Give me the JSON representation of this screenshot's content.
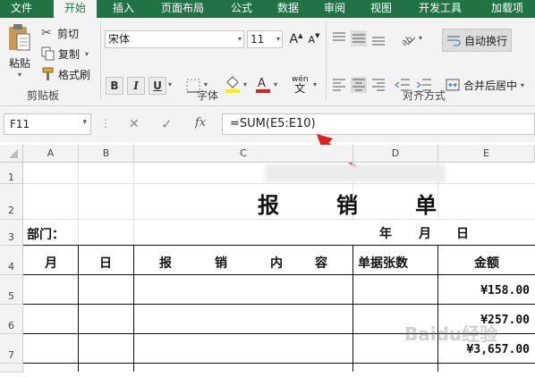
{
  "tabs": [
    {
      "label": "文件",
      "active": false
    },
    {
      "label": "开始",
      "active": true
    },
    {
      "label": "插入",
      "active": false
    },
    {
      "label": "页面布局",
      "active": false
    },
    {
      "label": "公式",
      "active": false
    },
    {
      "label": "数据",
      "active": false
    },
    {
      "label": "审阅",
      "active": false
    },
    {
      "label": "视图",
      "active": false
    },
    {
      "label": "开发工具",
      "active": false
    },
    {
      "label": "加载项",
      "active": false
    }
  ],
  "clipboard": {
    "paste": "粘贴",
    "cut": "剪切",
    "copy": "复制",
    "format_painter": "格式刷",
    "group_label": "剪贴板"
  },
  "font": {
    "name": "宋体",
    "size": "11",
    "bold": "B",
    "italic": "I",
    "underline": "U",
    "pinyin": "wén",
    "group_label": "字体",
    "grow": "A",
    "shrink": "A"
  },
  "alignment": {
    "wrap": "自动换行",
    "merge": "合并后居中",
    "group_label": "对齐方式"
  },
  "formula_bar": {
    "name_box": "F11",
    "cancel": "✕",
    "enter": "✓",
    "fx": "fx",
    "formula": "=SUM(E5:E10)"
  },
  "columns": [
    "A",
    "B",
    "C",
    "D",
    "E"
  ],
  "rows": [
    "1",
    "2",
    "3",
    "4",
    "5",
    "6",
    "7"
  ],
  "sheet": {
    "title_chars": [
      "报",
      "销",
      "单"
    ],
    "dept_label": "部门：",
    "date_parts": [
      "年",
      "月",
      "日"
    ],
    "headers": {
      "month": "月",
      "day": "日",
      "content_chars": [
        "报",
        "销",
        "内",
        "容"
      ],
      "doc_count": "单据张数",
      "amount": "金额"
    },
    "amounts": [
      "¥158.00",
      "¥257.00",
      "¥3,657.00"
    ]
  },
  "watermark": "Baidu经验",
  "colors": {
    "ribbon_green": "#217346",
    "ribbon_bg": "#f3f3f3",
    "accent_red": "#e02020"
  }
}
